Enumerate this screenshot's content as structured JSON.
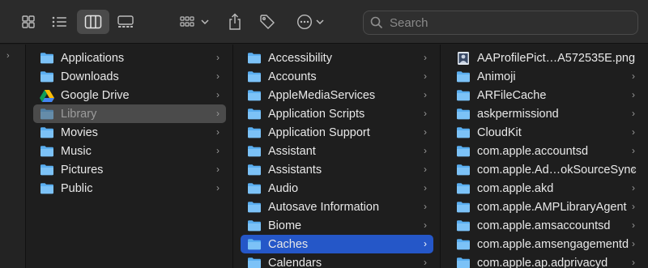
{
  "toolbar": {
    "view_icons": "icon-view-icon",
    "view_list": "list-view-icon",
    "view_columns": "column-view-icon",
    "view_gallery": "gallery-view-icon",
    "group": "group-icon",
    "share": "share-icon",
    "tag": "tag-icon",
    "more": "more-icon",
    "search_placeholder": "Search"
  },
  "columns": {
    "sidebar": [
      "Applications",
      "Downloads",
      "Google Drive",
      "Library",
      "Movies",
      "Music",
      "Pictures",
      "Public"
    ],
    "library": [
      "Accessibility",
      "Accounts",
      "AppleMediaServices",
      "Application Scripts",
      "Application Support",
      "Assistant",
      "Assistants",
      "Audio",
      "Autosave Information",
      "Biome",
      "Caches",
      "Calendars"
    ],
    "caches": [
      "AAProfilePict…A572535E.png",
      "Animoji",
      "ARFileCache",
      "askpermissiond",
      "CloudKit",
      "com.apple.accountsd",
      "com.apple.Ad…okSourceSync",
      "com.apple.akd",
      "com.apple.AMPLibraryAgent",
      "com.apple.amsaccountsd",
      "com.apple.amsengagementd",
      "com.apple.ap.adprivacyd"
    ]
  },
  "selection": {
    "sidebar": "Library",
    "library": "Caches"
  },
  "colors": {
    "folder": "#5aaef0",
    "selection_blue": "#2557c8",
    "selection_grey": "#4b4b4b"
  }
}
